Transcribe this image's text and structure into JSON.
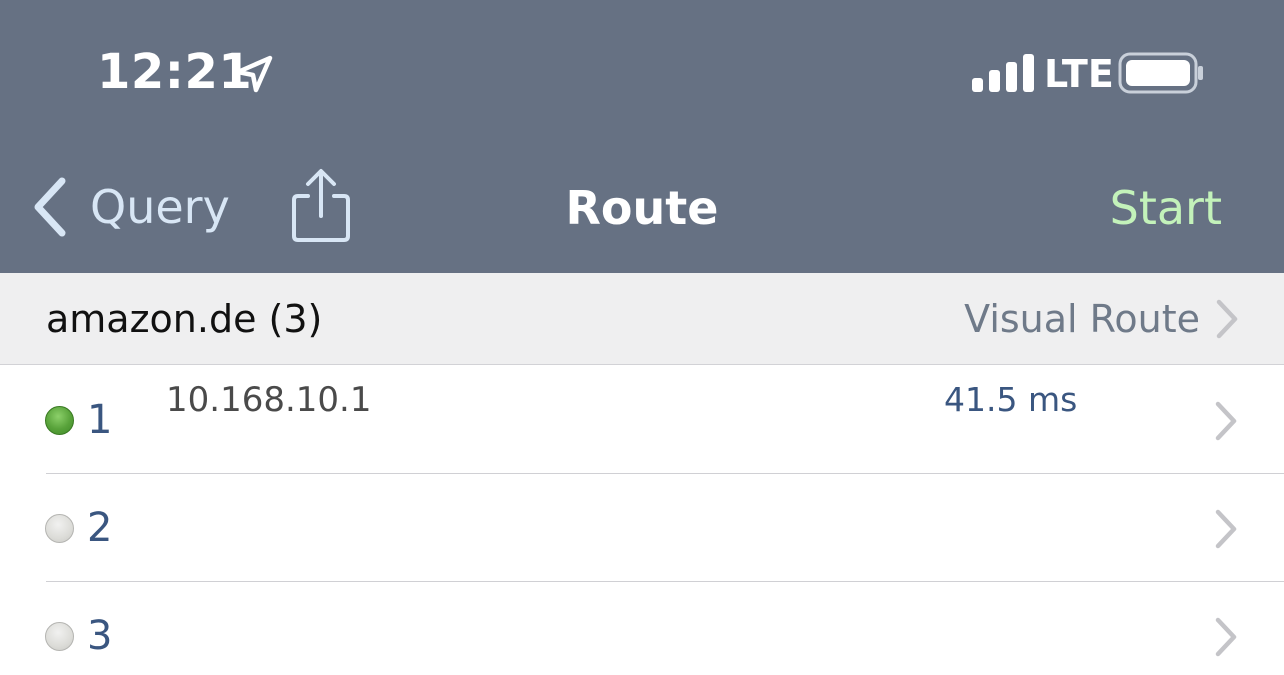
{
  "status_bar": {
    "time": "12:21",
    "network": "LTE",
    "location_icon": "location-arrow-icon",
    "signal_icon": "cellular-signal-icon",
    "battery_icon": "battery-icon"
  },
  "nav": {
    "back_label": "Query",
    "back_icon": "chevron-left-icon",
    "share_icon": "share-icon",
    "title": "Route",
    "action_label": "Start"
  },
  "section": {
    "host_label": "amazon.de (3)",
    "link_label": "Visual Route",
    "link_icon": "chevron-right-icon"
  },
  "hops": [
    {
      "number": "1",
      "ip": "10.168.10.1",
      "time": "41.5 ms",
      "status": "reached"
    },
    {
      "number": "2",
      "ip": "",
      "time": "",
      "status": "pending"
    },
    {
      "number": "3",
      "ip": "",
      "time": "",
      "status": "pending"
    }
  ],
  "colors": {
    "nav_background": "#667183",
    "start_accent": "#c3f2ba",
    "back_tint": "#d8e6f5",
    "status_reached": "#58a23a",
    "status_pending": "#dcdcd8",
    "hop_text": "#3a5680"
  }
}
